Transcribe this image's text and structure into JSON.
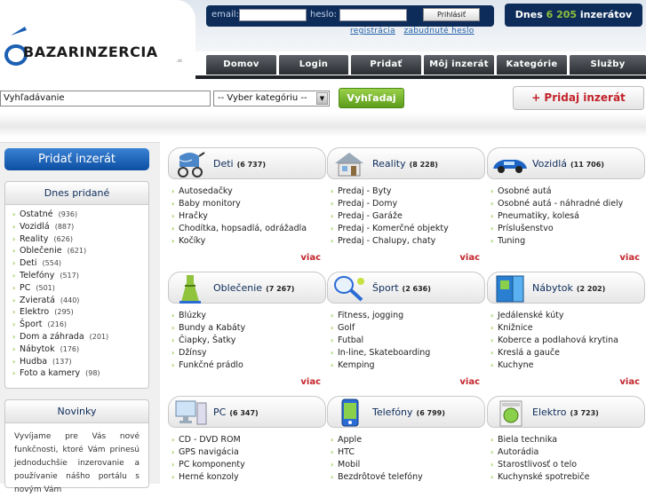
{
  "login": {
    "email_label": "email:",
    "password_label": "heslo:",
    "button": "Prihlásiť",
    "register": "registrácia",
    "forgot": "zabudnuté heslo"
  },
  "counter": {
    "prefix": "Dnes",
    "number": "6 205",
    "suffix": "inzerátov"
  },
  "logo": {
    "text": "BAZARINZERCIA",
    "suffix": ".sk"
  },
  "nav": [
    "Domov",
    "Login",
    "Pridať",
    "Môj inzerát",
    "Kategórie",
    "Služby"
  ],
  "search": {
    "value": "Vyhľadávanie",
    "category": "-- Vyber kategóriu --",
    "button": "Vyhľadaj",
    "add_button": "+ Pridaj inzerát"
  },
  "sidebar": {
    "add_button": "Pridať inzerát",
    "today_title": "Dnes pridané",
    "today": [
      {
        "name": "Ostatné",
        "count": "(936)"
      },
      {
        "name": "Vozidlá",
        "count": "(887)"
      },
      {
        "name": "Reality",
        "count": "(626)"
      },
      {
        "name": "Oblečenie",
        "count": "(621)"
      },
      {
        "name": "Deti",
        "count": "(554)"
      },
      {
        "name": "Telefóny",
        "count": "(517)"
      },
      {
        "name": "PC",
        "count": "(501)"
      },
      {
        "name": "Zvieratá",
        "count": "(440)"
      },
      {
        "name": "Elektro",
        "count": "(295)"
      },
      {
        "name": "Šport",
        "count": "(216)"
      },
      {
        "name": "Dom a záhrada",
        "count": "(201)"
      },
      {
        "name": "Nábytok",
        "count": "(176)"
      },
      {
        "name": "Hudba",
        "count": "(137)"
      },
      {
        "name": "Foto a kamery",
        "count": "(98)"
      }
    ],
    "news_title": "Novinky",
    "news_text": "Vyvíjame pre Vás nové funkčnosti, ktoré Vám prinesú jednoduchšie inzerovanie a používanie nášho portálu s novým Vám"
  },
  "more_label": "viac",
  "categories": [
    {
      "name": "Deti",
      "count": "(6 737)",
      "icon": "stroller-icon",
      "items": [
        "Autosedačky",
        "Baby monitory",
        "Hračky",
        "Chodítka, hopsadlá, odrážadla",
        "Kočíky"
      ]
    },
    {
      "name": "Reality",
      "count": "(8 228)",
      "icon": "house-icon",
      "items": [
        "Predaj - Byty",
        "Predaj - Domy",
        "Predaj - Garáže",
        "Predaj - Komerčné objekty",
        "Predaj - Chalupy, chaty"
      ]
    },
    {
      "name": "Vozidlá",
      "count": "(11 706)",
      "icon": "car-icon",
      "items": [
        "Osobné autá",
        "Osobné autá - náhradné diely",
        "Pneumatiky, kolesá",
        "Príslušenstvo",
        "Tuning"
      ]
    },
    {
      "name": "Oblečenie",
      "count": "(7 267)",
      "icon": "dress-icon",
      "items": [
        "Blúzky",
        "Bundy a Kabáty",
        "Čiapky, Šatky",
        "Džínsy",
        "Funkčné prádlo"
      ]
    },
    {
      "name": "Šport",
      "count": "(2 636)",
      "icon": "tennis-racket-icon",
      "items": [
        "Fitness, jogging",
        "Golf",
        "Futbal",
        "In-line, Skateboarding",
        "Kemping"
      ]
    },
    {
      "name": "Nábytok",
      "count": "(2 202)",
      "icon": "wardrobe-icon",
      "items": [
        "Jedálenské kúty",
        "Knižnice",
        "Koberce a podlahová krytina",
        "Kreslá a gauče",
        "Kuchyne"
      ]
    },
    {
      "name": "PC",
      "count": "(6 347)",
      "icon": "computer-icon",
      "items": [
        "CD - DVD ROM",
        "GPS navigácia",
        "PC komponenty",
        "Herné konzoly"
      ]
    },
    {
      "name": "Telefóny",
      "count": "(6 799)",
      "icon": "phone-icon",
      "items": [
        "Apple",
        "HTC",
        "Mobil",
        "Bezdrôtové telefóny"
      ]
    },
    {
      "name": "Elektro",
      "count": "(3 723)",
      "icon": "washing-machine-icon",
      "items": [
        "Biela technika",
        "Autorádia",
        "Starostlivosť o telo",
        "Kuchynské spotrebiče"
      ]
    }
  ],
  "colors": {
    "navy": "#0d2c5a",
    "green": "#8ec13c",
    "red": "#c2232a",
    "blue": "#0c4ea2"
  }
}
